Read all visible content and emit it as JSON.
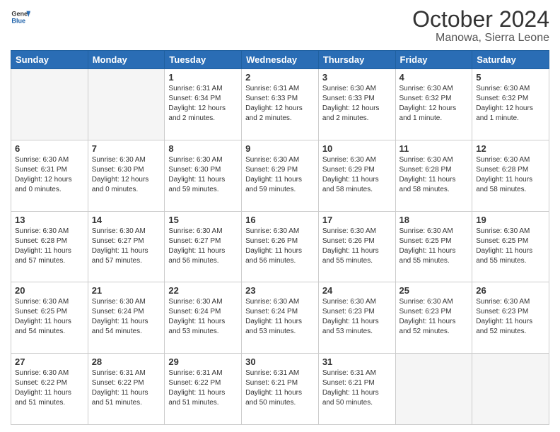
{
  "header": {
    "logo_general": "General",
    "logo_blue": "Blue",
    "month": "October 2024",
    "location": "Manowa, Sierra Leone"
  },
  "weekdays": [
    "Sunday",
    "Monday",
    "Tuesday",
    "Wednesday",
    "Thursday",
    "Friday",
    "Saturday"
  ],
  "weeks": [
    [
      {
        "day": "",
        "empty": true
      },
      {
        "day": "",
        "empty": true
      },
      {
        "day": "1",
        "sunrise": "Sunrise: 6:31 AM",
        "sunset": "Sunset: 6:34 PM",
        "daylight": "Daylight: 12 hours and 2 minutes."
      },
      {
        "day": "2",
        "sunrise": "Sunrise: 6:31 AM",
        "sunset": "Sunset: 6:33 PM",
        "daylight": "Daylight: 12 hours and 2 minutes."
      },
      {
        "day": "3",
        "sunrise": "Sunrise: 6:30 AM",
        "sunset": "Sunset: 6:33 PM",
        "daylight": "Daylight: 12 hours and 2 minutes."
      },
      {
        "day": "4",
        "sunrise": "Sunrise: 6:30 AM",
        "sunset": "Sunset: 6:32 PM",
        "daylight": "Daylight: 12 hours and 1 minute."
      },
      {
        "day": "5",
        "sunrise": "Sunrise: 6:30 AM",
        "sunset": "Sunset: 6:32 PM",
        "daylight": "Daylight: 12 hours and 1 minute."
      }
    ],
    [
      {
        "day": "6",
        "sunrise": "Sunrise: 6:30 AM",
        "sunset": "Sunset: 6:31 PM",
        "daylight": "Daylight: 12 hours and 0 minutes."
      },
      {
        "day": "7",
        "sunrise": "Sunrise: 6:30 AM",
        "sunset": "Sunset: 6:30 PM",
        "daylight": "Daylight: 12 hours and 0 minutes."
      },
      {
        "day": "8",
        "sunrise": "Sunrise: 6:30 AM",
        "sunset": "Sunset: 6:30 PM",
        "daylight": "Daylight: 11 hours and 59 minutes."
      },
      {
        "day": "9",
        "sunrise": "Sunrise: 6:30 AM",
        "sunset": "Sunset: 6:29 PM",
        "daylight": "Daylight: 11 hours and 59 minutes."
      },
      {
        "day": "10",
        "sunrise": "Sunrise: 6:30 AM",
        "sunset": "Sunset: 6:29 PM",
        "daylight": "Daylight: 11 hours and 58 minutes."
      },
      {
        "day": "11",
        "sunrise": "Sunrise: 6:30 AM",
        "sunset": "Sunset: 6:28 PM",
        "daylight": "Daylight: 11 hours and 58 minutes."
      },
      {
        "day": "12",
        "sunrise": "Sunrise: 6:30 AM",
        "sunset": "Sunset: 6:28 PM",
        "daylight": "Daylight: 11 hours and 58 minutes."
      }
    ],
    [
      {
        "day": "13",
        "sunrise": "Sunrise: 6:30 AM",
        "sunset": "Sunset: 6:28 PM",
        "daylight": "Daylight: 11 hours and 57 minutes."
      },
      {
        "day": "14",
        "sunrise": "Sunrise: 6:30 AM",
        "sunset": "Sunset: 6:27 PM",
        "daylight": "Daylight: 11 hours and 57 minutes."
      },
      {
        "day": "15",
        "sunrise": "Sunrise: 6:30 AM",
        "sunset": "Sunset: 6:27 PM",
        "daylight": "Daylight: 11 hours and 56 minutes."
      },
      {
        "day": "16",
        "sunrise": "Sunrise: 6:30 AM",
        "sunset": "Sunset: 6:26 PM",
        "daylight": "Daylight: 11 hours and 56 minutes."
      },
      {
        "day": "17",
        "sunrise": "Sunrise: 6:30 AM",
        "sunset": "Sunset: 6:26 PM",
        "daylight": "Daylight: 11 hours and 55 minutes."
      },
      {
        "day": "18",
        "sunrise": "Sunrise: 6:30 AM",
        "sunset": "Sunset: 6:25 PM",
        "daylight": "Daylight: 11 hours and 55 minutes."
      },
      {
        "day": "19",
        "sunrise": "Sunrise: 6:30 AM",
        "sunset": "Sunset: 6:25 PM",
        "daylight": "Daylight: 11 hours and 55 minutes."
      }
    ],
    [
      {
        "day": "20",
        "sunrise": "Sunrise: 6:30 AM",
        "sunset": "Sunset: 6:25 PM",
        "daylight": "Daylight: 11 hours and 54 minutes."
      },
      {
        "day": "21",
        "sunrise": "Sunrise: 6:30 AM",
        "sunset": "Sunset: 6:24 PM",
        "daylight": "Daylight: 11 hours and 54 minutes."
      },
      {
        "day": "22",
        "sunrise": "Sunrise: 6:30 AM",
        "sunset": "Sunset: 6:24 PM",
        "daylight": "Daylight: 11 hours and 53 minutes."
      },
      {
        "day": "23",
        "sunrise": "Sunrise: 6:30 AM",
        "sunset": "Sunset: 6:24 PM",
        "daylight": "Daylight: 11 hours and 53 minutes."
      },
      {
        "day": "24",
        "sunrise": "Sunrise: 6:30 AM",
        "sunset": "Sunset: 6:23 PM",
        "daylight": "Daylight: 11 hours and 53 minutes."
      },
      {
        "day": "25",
        "sunrise": "Sunrise: 6:30 AM",
        "sunset": "Sunset: 6:23 PM",
        "daylight": "Daylight: 11 hours and 52 minutes."
      },
      {
        "day": "26",
        "sunrise": "Sunrise: 6:30 AM",
        "sunset": "Sunset: 6:23 PM",
        "daylight": "Daylight: 11 hours and 52 minutes."
      }
    ],
    [
      {
        "day": "27",
        "sunrise": "Sunrise: 6:30 AM",
        "sunset": "Sunset: 6:22 PM",
        "daylight": "Daylight: 11 hours and 51 minutes."
      },
      {
        "day": "28",
        "sunrise": "Sunrise: 6:31 AM",
        "sunset": "Sunset: 6:22 PM",
        "daylight": "Daylight: 11 hours and 51 minutes."
      },
      {
        "day": "29",
        "sunrise": "Sunrise: 6:31 AM",
        "sunset": "Sunset: 6:22 PM",
        "daylight": "Daylight: 11 hours and 51 minutes."
      },
      {
        "day": "30",
        "sunrise": "Sunrise: 6:31 AM",
        "sunset": "Sunset: 6:21 PM",
        "daylight": "Daylight: 11 hours and 50 minutes."
      },
      {
        "day": "31",
        "sunrise": "Sunrise: 6:31 AM",
        "sunset": "Sunset: 6:21 PM",
        "daylight": "Daylight: 11 hours and 50 minutes."
      },
      {
        "day": "",
        "empty": true
      },
      {
        "day": "",
        "empty": true
      }
    ]
  ]
}
